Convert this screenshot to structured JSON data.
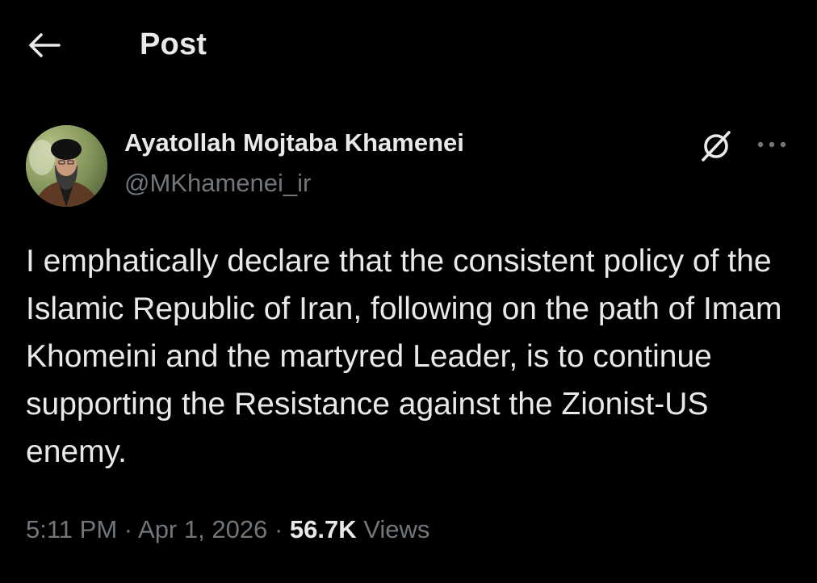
{
  "header": {
    "back_icon": "arrow-left-icon",
    "title": "Post"
  },
  "post": {
    "author": {
      "display_name": "Ayatollah Mojtaba Khamenei",
      "handle": "@MKhamenei_ir",
      "avatar": "profile-photo"
    },
    "grok_icon": "grok-slash-circle-icon",
    "more_icon": "more-horizontal-icon",
    "text": "I emphatically declare that the consistent policy of the Islamic Republic of Iran, following on the path of Imam Khomeini and the martyred Leader, is to continue supporting the Resistance against the Zionist-US enemy.",
    "meta": {
      "time": "5:11 PM",
      "separator": "·",
      "date": "Apr 1, 2026",
      "views_count": "56.7K",
      "views_label": "Views"
    }
  },
  "colors": {
    "background": "#000000",
    "primary_text": "#e7e9ea",
    "secondary_text": "#71767b"
  }
}
